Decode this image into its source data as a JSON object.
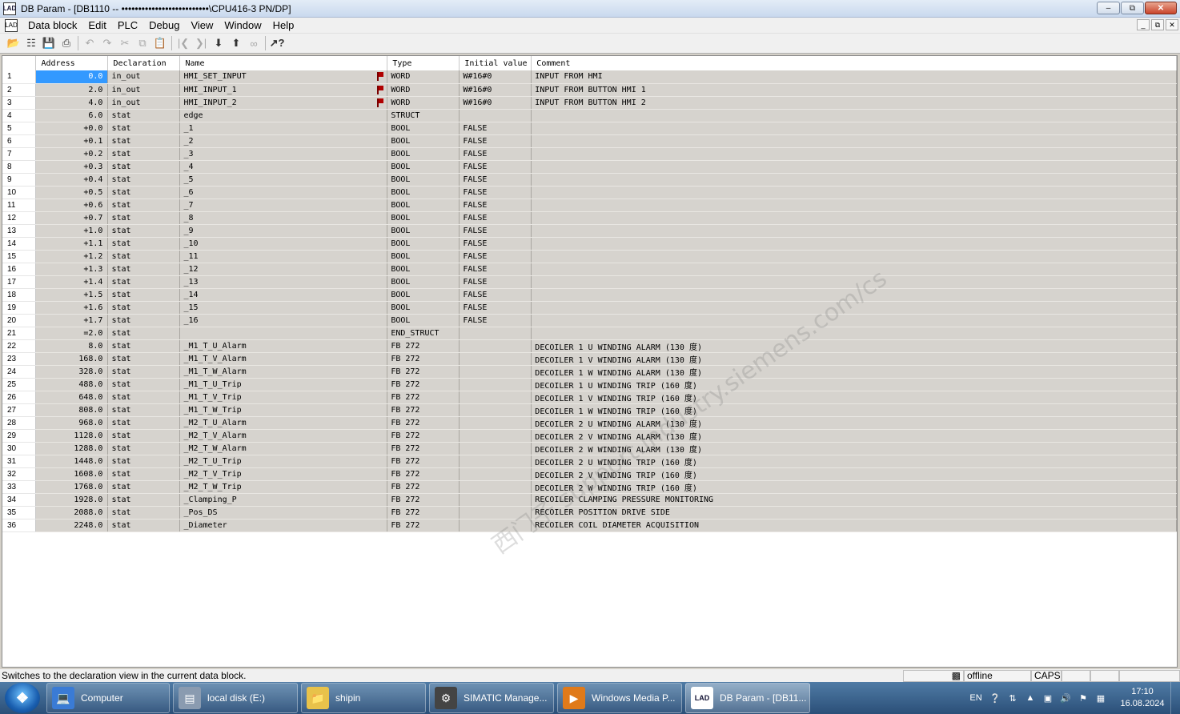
{
  "window": {
    "app_icon_label": "LAD",
    "title": "DB Param - [DB1110 -- ••••••••••••••••••••••••••\\CPU416-3 PN/DP]",
    "minimize": "–",
    "maximize": "⧉",
    "close": "✕"
  },
  "menu": {
    "items": [
      "Data block",
      "Edit",
      "PLC",
      "Debug",
      "View",
      "Window",
      "Help"
    ],
    "mdi_minimize": "_",
    "mdi_restore": "⧉",
    "mdi_close": "✕"
  },
  "toolbar": {
    "icons": [
      "open-icon",
      "network-icon",
      "save-icon",
      "print-icon",
      "undo-icon",
      "redo-icon",
      "cut-icon",
      "copy-icon",
      "paste-icon",
      "first-icon",
      "last-icon",
      "download-icon",
      "upload-icon",
      "monitor-icon",
      "help-icon"
    ]
  },
  "table": {
    "headers": [
      "Address",
      "Declaration",
      "Name",
      "Type",
      "Initial value",
      "Comment"
    ],
    "rows": [
      {
        "n": "1",
        "addr": "0.0",
        "decl": "in_out",
        "name": "HMI_SET_INPUT",
        "flag": true,
        "type": "WORD",
        "init": "W#16#0",
        "comment": "INPUT FROM HMI"
      },
      {
        "n": "2",
        "addr": "2.0",
        "decl": "in_out",
        "name": "HMI_INPUT_1",
        "flag": true,
        "type": "WORD",
        "init": "W#16#0",
        "comment": "INPUT FROM BUTTON  HMI 1"
      },
      {
        "n": "3",
        "addr": "4.0",
        "decl": "in_out",
        "name": "HMI_INPUT_2",
        "flag": true,
        "type": "WORD",
        "init": "W#16#0",
        "comment": "INPUT FROM BUTTON  HMI 2"
      },
      {
        "n": "4",
        "addr": "6.0",
        "decl": "stat",
        "name": "edge",
        "flag": false,
        "type": "STRUCT",
        "init": "",
        "comment": ""
      },
      {
        "n": "5",
        "addr": "+0.0",
        "decl": "stat",
        "name": " _1",
        "flag": false,
        "type": "BOOL",
        "init": "FALSE",
        "comment": ""
      },
      {
        "n": "6",
        "addr": "+0.1",
        "decl": "stat",
        "name": " _2",
        "flag": false,
        "type": "BOOL",
        "init": "FALSE",
        "comment": ""
      },
      {
        "n": "7",
        "addr": "+0.2",
        "decl": "stat",
        "name": " _3",
        "flag": false,
        "type": "BOOL",
        "init": "FALSE",
        "comment": ""
      },
      {
        "n": "8",
        "addr": "+0.3",
        "decl": "stat",
        "name": " _4",
        "flag": false,
        "type": "BOOL",
        "init": "FALSE",
        "comment": ""
      },
      {
        "n": "9",
        "addr": "+0.4",
        "decl": "stat",
        "name": " _5",
        "flag": false,
        "type": "BOOL",
        "init": "FALSE",
        "comment": ""
      },
      {
        "n": "10",
        "addr": "+0.5",
        "decl": "stat",
        "name": " _6",
        "flag": false,
        "type": "BOOL",
        "init": "FALSE",
        "comment": ""
      },
      {
        "n": "11",
        "addr": "+0.6",
        "decl": "stat",
        "name": " _7",
        "flag": false,
        "type": "BOOL",
        "init": "FALSE",
        "comment": ""
      },
      {
        "n": "12",
        "addr": "+0.7",
        "decl": "stat",
        "name": " _8",
        "flag": false,
        "type": "BOOL",
        "init": "FALSE",
        "comment": ""
      },
      {
        "n": "13",
        "addr": "+1.0",
        "decl": "stat",
        "name": " _9",
        "flag": false,
        "type": "BOOL",
        "init": "FALSE",
        "comment": ""
      },
      {
        "n": "14",
        "addr": "+1.1",
        "decl": "stat",
        "name": " _10",
        "flag": false,
        "type": "BOOL",
        "init": "FALSE",
        "comment": ""
      },
      {
        "n": "15",
        "addr": "+1.2",
        "decl": "stat",
        "name": " _11",
        "flag": false,
        "type": "BOOL",
        "init": "FALSE",
        "comment": ""
      },
      {
        "n": "16",
        "addr": "+1.3",
        "decl": "stat",
        "name": " _12",
        "flag": false,
        "type": "BOOL",
        "init": "FALSE",
        "comment": ""
      },
      {
        "n": "17",
        "addr": "+1.4",
        "decl": "stat",
        "name": " _13",
        "flag": false,
        "type": "BOOL",
        "init": "FALSE",
        "comment": ""
      },
      {
        "n": "18",
        "addr": "+1.5",
        "decl": "stat",
        "name": " _14",
        "flag": false,
        "type": "BOOL",
        "init": "FALSE",
        "comment": ""
      },
      {
        "n": "19",
        "addr": "+1.6",
        "decl": "stat",
        "name": " _15",
        "flag": false,
        "type": "BOOL",
        "init": "FALSE",
        "comment": ""
      },
      {
        "n": "20",
        "addr": "+1.7",
        "decl": "stat",
        "name": " _16",
        "flag": false,
        "type": "BOOL",
        "init": "FALSE",
        "comment": ""
      },
      {
        "n": "21",
        "addr": "=2.0",
        "decl": "stat",
        "name": "",
        "flag": false,
        "type": "END_STRUCT",
        "init": "",
        "comment": ""
      },
      {
        "n": "22",
        "addr": "8.0",
        "decl": "stat",
        "name": "_M1_T_U_Alarm",
        "flag": false,
        "type": "FB 272",
        "init": "",
        "comment": "DECOILER 1 U WINDING ALARM (130 度)"
      },
      {
        "n": "23",
        "addr": "168.0",
        "decl": "stat",
        "name": "_M1_T_V_Alarm",
        "flag": false,
        "type": "FB 272",
        "init": "",
        "comment": "DECOILER 1 V WINDING ALARM (130 度)"
      },
      {
        "n": "24",
        "addr": "328.0",
        "decl": "stat",
        "name": "_M1_T_W_Alarm",
        "flag": false,
        "type": "FB 272",
        "init": "",
        "comment": "DECOILER 1 W WINDING ALARM (130 度)"
      },
      {
        "n": "25",
        "addr": "488.0",
        "decl": "stat",
        "name": "_M1_T_U_Trip",
        "flag": false,
        "type": "FB 272",
        "init": "",
        "comment": "DECOILER 1 U WINDING TRIP (160 度)"
      },
      {
        "n": "26",
        "addr": "648.0",
        "decl": "stat",
        "name": "_M1_T_V_Trip",
        "flag": false,
        "type": "FB 272",
        "init": "",
        "comment": "DECOILER 1 V WINDING TRIP (160 度)"
      },
      {
        "n": "27",
        "addr": "808.0",
        "decl": "stat",
        "name": "_M1_T_W_Trip",
        "flag": false,
        "type": "FB 272",
        "init": "",
        "comment": "DECOILER 1 W WINDING TRIP (160 度)"
      },
      {
        "n": "28",
        "addr": "968.0",
        "decl": "stat",
        "name": "_M2_T_U_Alarm",
        "flag": false,
        "type": "FB 272",
        "init": "",
        "comment": "DECOILER 2 U WINDING ALARM (130 度)"
      },
      {
        "n": "29",
        "addr": "1128.0",
        "decl": "stat",
        "name": "_M2_T_V_Alarm",
        "flag": false,
        "type": "FB 272",
        "init": "",
        "comment": "DECOILER 2 V WINDING ALARM (130 度)"
      },
      {
        "n": "30",
        "addr": "1288.0",
        "decl": "stat",
        "name": "_M2_T_W_Alarm",
        "flag": false,
        "type": "FB 272",
        "init": "",
        "comment": "DECOILER 2 W WINDING ALARM (130 度)"
      },
      {
        "n": "31",
        "addr": "1448.0",
        "decl": "stat",
        "name": "_M2_T_U_Trip",
        "flag": false,
        "type": "FB 272",
        "init": "",
        "comment": "DECOILER 2 U WINDING TRIP (160 度)"
      },
      {
        "n": "32",
        "addr": "1608.0",
        "decl": "stat",
        "name": "_M2_T_V_Trip",
        "flag": false,
        "type": "FB 272",
        "init": "",
        "comment": "DECOILER 2 V WINDING TRIP (160 度)"
      },
      {
        "n": "33",
        "addr": "1768.0",
        "decl": "stat",
        "name": "_M2_T_W_Trip",
        "flag": false,
        "type": "FB 272",
        "init": "",
        "comment": "DECOILER 2 W WINDING TRIP (160 度)"
      },
      {
        "n": "34",
        "addr": "1928.0",
        "decl": "stat",
        "name": "_Clamping_P",
        "flag": false,
        "type": "FB 272",
        "init": "",
        "comment": "RECOILER CLAMPING PRESSURE MONITORING"
      },
      {
        "n": "35",
        "addr": "2088.0",
        "decl": "stat",
        "name": "_Pos_DS",
        "flag": false,
        "type": "FB 272",
        "init": "",
        "comment": "RECOILER POSITION DRIVE SIDE"
      },
      {
        "n": "36",
        "addr": "2248.0",
        "decl": "stat",
        "name": "_Diameter",
        "flag": false,
        "type": "FB 272",
        "init": "",
        "comment": "RECOILER COIL DIAMETER ACQUISITION"
      }
    ]
  },
  "watermark": "西门子 support.industry.siemens.com/cs",
  "statusbar": {
    "message": "Switches to the declaration view in the current data block.",
    "mode": "offline",
    "caps": "CAPS"
  },
  "taskbar": {
    "items": [
      {
        "label": "Computer",
        "icon": "computer-icon",
        "color": "#3a7bd5"
      },
      {
        "label": "local disk (E:)",
        "icon": "drive-icon",
        "color": "#8a9bb0"
      },
      {
        "label": "shipin",
        "icon": "folder-icon",
        "color": "#e8c24a"
      },
      {
        "label": "SIMATIC Manage...",
        "icon": "simatic-icon",
        "color": "#444444"
      },
      {
        "label": "Windows Media P...",
        "icon": "media-player-icon",
        "color": "#e07a1a"
      },
      {
        "label": "DB Param - [DB11...",
        "icon": "lad-icon",
        "color": "#ffffff"
      }
    ],
    "lang": "EN",
    "time": "17:10",
    "date": "16.08.2024"
  }
}
